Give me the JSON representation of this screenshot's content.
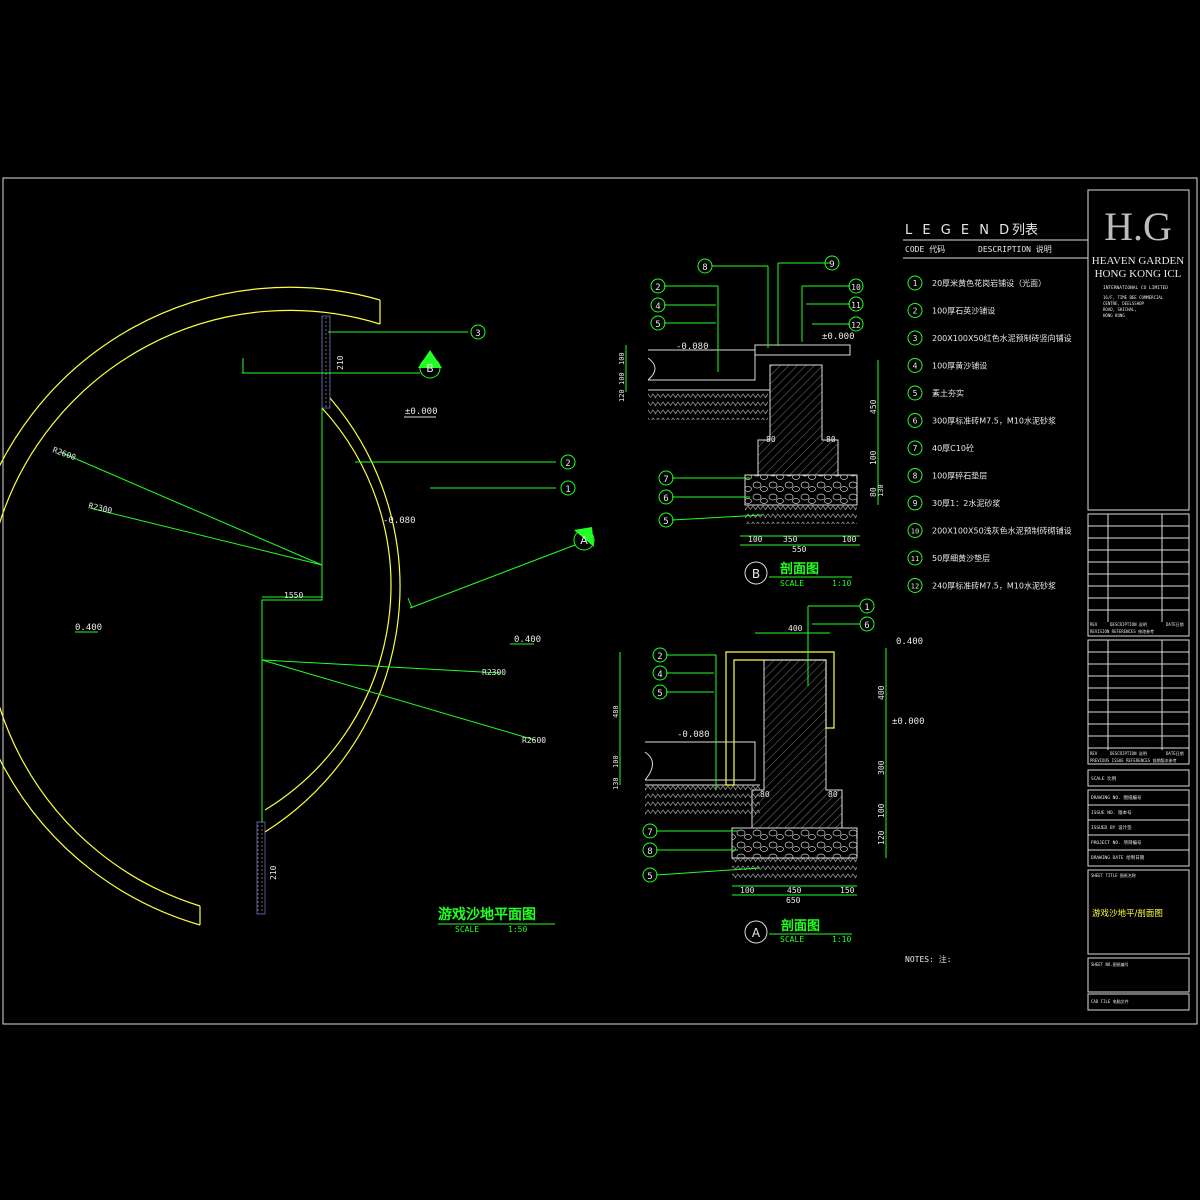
{
  "plan": {
    "title": "游戏沙地平面图",
    "scale_label": "SCALE",
    "scale_value": "1:50",
    "levels": [
      "±0.000",
      "-0.080",
      "0.400",
      "0.400"
    ],
    "dims": [
      "R2600",
      "R2300",
      "R2300",
      "R2600",
      "1550",
      "210",
      "210"
    ],
    "callouts": [
      "3",
      "2",
      "1"
    ],
    "section_marks": [
      "B",
      "A"
    ]
  },
  "section_b": {
    "mark": "B",
    "title": "剖面图",
    "scale_label": "SCALE",
    "scale_value": "1:10",
    "levels": [
      "-0.080",
      "±0.000"
    ],
    "dims": [
      "100",
      "350",
      "100",
      "550",
      "80",
      "80",
      "450",
      "100",
      "80",
      "100",
      "100",
      "120",
      "130"
    ],
    "callouts_left": [
      "2",
      "4",
      "5",
      "7",
      "6",
      "5"
    ],
    "callouts_right": [
      "8",
      "9",
      "10",
      "11",
      "12"
    ]
  },
  "section_a": {
    "mark": "A",
    "title": "剖面图",
    "scale_label": "SCALE",
    "scale_value": "1:10",
    "levels": [
      "-0.080",
      "0.400",
      "±0.000"
    ],
    "dims": [
      "400",
      "100",
      "450",
      "150",
      "650",
      "80",
      "80",
      "400",
      "300",
      "100",
      "120",
      "100",
      "130",
      "480"
    ],
    "callouts_left": [
      "2",
      "4",
      "5",
      "7",
      "8",
      "5"
    ],
    "callouts_right": [
      "1",
      "6"
    ]
  },
  "legend": {
    "title": "L E G E N D",
    "title_cn": "列表",
    "col_code": "CODE 代码",
    "col_desc": "DESCRIPTION 说明",
    "items": [
      {
        "code": "1",
        "desc": "20厚米黄色花岗岩铺设（光面）"
      },
      {
        "code": "2",
        "desc": "100厚石英沙铺设"
      },
      {
        "code": "3",
        "desc": "200X100X50红色水泥预制砖竖向铺设"
      },
      {
        "code": "4",
        "desc": "100厚黄沙铺设"
      },
      {
        "code": "5",
        "desc": "素土夯实"
      },
      {
        "code": "6",
        "desc": "300厚标准砖M7.5，M10水泥砂浆"
      },
      {
        "code": "7",
        "desc": "40厚C10砼"
      },
      {
        "code": "8",
        "desc": "100厚碎石垫层"
      },
      {
        "code": "9",
        "desc": "30厚1：2水泥砂浆"
      },
      {
        "code": "10",
        "desc": "200X100X50浅灰色水泥预制砖砌铺设"
      },
      {
        "code": "11",
        "desc": "50厚细黄沙垫层"
      },
      {
        "code": "12",
        "desc": "240厚标准砖M7.5，M10水泥砂浆"
      }
    ]
  },
  "notes": "NOTES: 注:",
  "title_block": {
    "logo": "H.G",
    "company_1": "HEAVEN GARDEN",
    "company_2": "HONG KONG ICL",
    "company_3": "INTERNATIONAL CO LIMITED",
    "address": [
      "16/F, TIME BEE COMMERCIAL",
      "CENTRE, DEELSSHOP",
      "ROAD, SHICHAL,",
      "HONG KONG"
    ],
    "rev_headers_1": [
      "REV",
      "DESCRIPTION 说明",
      "DATE日期"
    ],
    "rev_caption_1": "REVISION REFERENCES 修改参考",
    "rev_headers_2": [
      "REV",
      "DESCRIPTION 说明",
      "DATE日期"
    ],
    "rev_caption_2": "PREVIOUS ISSUE REFERENCES 前期版本参考",
    "scale_row": "SCALE 比例",
    "fields": [
      "DRAWING NO. 图纸编号",
      "ISSUE NO. 版本号",
      "ISSUED BY 设计签",
      "PROJECT NO. 项目编号",
      "DRAWING DATE 绘制日期"
    ],
    "sheet_title_label": "SHEET TITLE 图纸名称",
    "sheet_title": "游戏沙地平/剖面图",
    "sheet_no": "SHEET NO.图纸编号",
    "cad_file": "CAD FILE 电脑文件"
  }
}
